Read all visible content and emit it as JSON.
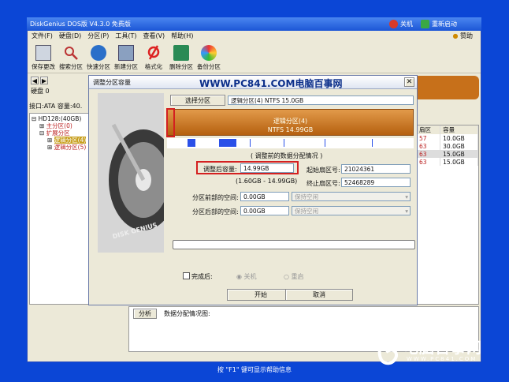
{
  "window": {
    "title": "DiskGenius DOS版 V4.3.0 免费版",
    "shutdown": "关机",
    "restart": "重新启动"
  },
  "menu": [
    "文件(F)",
    "硬盘(D)",
    "分区(P)",
    "工具(T)",
    "查看(V)",
    "帮助(H)"
  ],
  "sponsor": "赞助",
  "toolbar": [
    "保存更改",
    "搜索分区",
    "快速分区",
    "新建分区",
    "格式化",
    "删除分区",
    "备份分区"
  ],
  "disk_info": {
    "label": "硬盘 0",
    "iface": "接口:ATA",
    "capacity": "容量:40."
  },
  "tree": [
    "HD128:(40GB)",
    "主分区(0)",
    "扩展分区",
    "逻辑分区(4)",
    "逻辑分区(5)"
  ],
  "table": {
    "headers": [
      "扇区",
      "容量"
    ],
    "rows": [
      [
        "57",
        "10.0GB"
      ],
      [
        "63",
        "30.0GB"
      ],
      [
        "63",
        "15.0GB"
      ],
      [
        "63",
        "15.0GB"
      ]
    ]
  },
  "bottom": {
    "analyze": "分析",
    "layout": "数据分配情况图:"
  },
  "status": "按 \"F1\" 键可显示帮助信息",
  "watermark": {
    "brand": "电脑百事网",
    "url": "WWW.PC841.COM"
  },
  "dialog": {
    "title": "调整分区容量",
    "banner": "WWW.PC841.COM电脑百事网",
    "select_button": "选择分区",
    "selected_partition": "逻辑分区(4) NTFS 15.0GB",
    "bar_label": "逻辑分区(4)",
    "bar_sub": "NTFS 14.99GB",
    "section": "( 调整前的数据分配情况 )",
    "resize_label": "调整后容量:",
    "resize_value": "14.99GB",
    "range": "(1.60GB - 14.99GB)",
    "start_label": "起始扇区号:",
    "start_value": "21024361",
    "end_label": "终止扇区号:",
    "end_value": "52468289",
    "before_label": "分区前部的空间:",
    "before_value": "0.00GB",
    "before_option": "保持空闲",
    "after_label": "分区后部的空间:",
    "after_value": "0.00GB",
    "after_option": "保持空闲",
    "disk_label": "DISK GENIUS",
    "done_label": "完成后:",
    "opt_shutdown": "关机",
    "opt_restart": "重启",
    "start_button": "开始",
    "cancel_button": "取消"
  },
  "colors": {
    "desktop": "#0b46d6",
    "partition": "#c7701a",
    "highlight": "#d42020"
  }
}
